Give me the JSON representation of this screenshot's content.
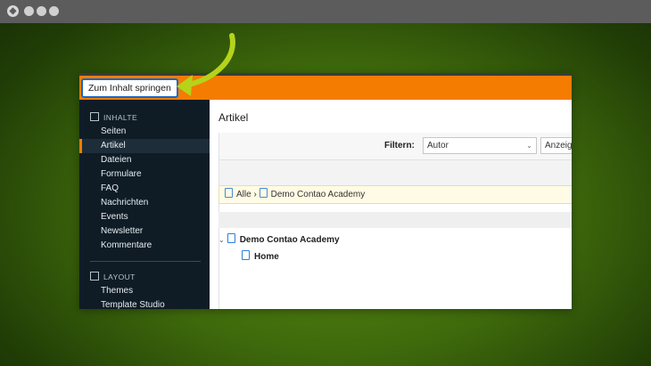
{
  "skip_link": {
    "label": "Zum Inhalt springen"
  },
  "sidebar": {
    "groups": [
      {
        "label": "INHALTE",
        "icon": "edit-icon"
      },
      {
        "label": "LAYOUT",
        "icon": "layout-icon"
      }
    ],
    "items": [
      {
        "label": "Seiten"
      },
      {
        "label": "Artikel",
        "active": true
      },
      {
        "label": "Dateien"
      },
      {
        "label": "Formulare"
      },
      {
        "label": "FAQ"
      },
      {
        "label": "Nachrichten"
      },
      {
        "label": "Events"
      },
      {
        "label": "Newsletter"
      },
      {
        "label": "Kommentare"
      },
      {
        "label": "Themes"
      },
      {
        "label": "Template Studio"
      }
    ]
  },
  "main": {
    "title": "Artikel",
    "filter_label": "Filtern:",
    "filter_select": {
      "value": "Autor"
    },
    "display_select": {
      "value": "Anzeigen"
    },
    "breadcrumb": {
      "root": "Alle",
      "separator": "›",
      "current": "Demo Contao Academy"
    },
    "tree": [
      {
        "label": "Demo Contao Academy",
        "level": 0
      },
      {
        "label": "Home",
        "level": 1
      }
    ]
  },
  "colors": {
    "accent": "#f47c00",
    "sidebar_bg": "#0f1c26",
    "arrow": "#b5d31a",
    "focus": "#1a66c8"
  }
}
